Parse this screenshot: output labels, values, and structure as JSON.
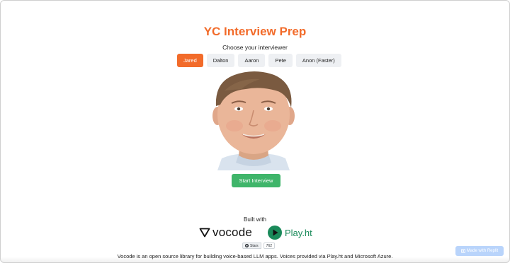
{
  "header": {
    "title": "YC Interview Prep",
    "subtitle": "Choose your interviewer"
  },
  "interviewers": {
    "selected": "Jared",
    "tabs": [
      {
        "label": "Jared"
      },
      {
        "label": "Dalton"
      },
      {
        "label": "Aaron"
      },
      {
        "label": "Pete"
      },
      {
        "label": "Anon (Faster)"
      }
    ]
  },
  "main": {
    "start_label": "Start Interview"
  },
  "footer": {
    "built_with": "Built with",
    "vocode_logo_text": "vocode",
    "playht_logo_text": "Play.ht",
    "github": {
      "stars_label": "Stars",
      "stars_count": "762"
    },
    "description": "Vocode is an open source library for building voice-based LLM apps. Voices provided via Play.ht and Microsoft Azure.",
    "made_with": "Made with Replit"
  },
  "colors": {
    "accent": "#f26b2a",
    "start_button": "#3fb56a",
    "playht": "#1a8a5a",
    "replit_badge": "#b9d4fb"
  }
}
